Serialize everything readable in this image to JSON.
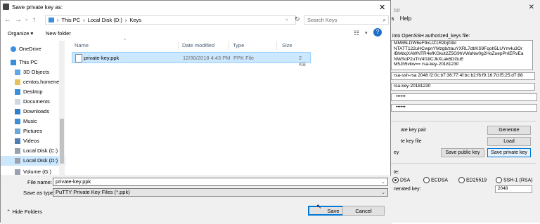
{
  "background_window": {
    "title_fragment": "tor",
    "menu": [
      "ns",
      "Help"
    ],
    "pubkey_label": "into OpenSSH authorized_keys file:",
    "pubkey_lines": [
      "MM85LDW6eF9xLtZ1R2bj03kl",
      "NTATT122uHCwpnYMzgb/zauYXRL7dt/KS9Fqoh5LUYm4u3Or",
      "IBMdqXAWNTR4efKGkut2Z5G9hVWaNw0g2HoZuepPnIERvEa",
      "NWSoP2uTn/4f1ltCJkXLak6DGuE",
      "M5Jh5vkw== rsa-key-20181230"
    ],
    "fingerprint": "rsa-ssh-rsa 2048 f2:0c:b7:36:77:4f:bc:b2:f6:f9:16:7d:f5:25:d7:88",
    "comment": "rsa-key-20181230",
    "passphrase": "••••••",
    "confirm": "••••••",
    "gen_label": "ate key pair",
    "load_label": "te key file",
    "save_label": "ey",
    "generate_btn": "Generate",
    "load_btn": "Load",
    "save_public_btn": "Save public key",
    "save_private_btn": "Save private key",
    "type_label": "te:",
    "radio_rsa": "DSA",
    "radio_ecdsa": "ECDSA",
    "radio_ed25519": "ED25519",
    "radio_ssh1": "SSH-1 (RSA)",
    "bits_label": "nerated key:",
    "bits_value": "2048"
  },
  "dialog": {
    "title": "Save private key as:",
    "close": "✕",
    "breadcrumb": [
      "This PC",
      "Local Disk (D:)",
      "Keys"
    ],
    "search_placeholder": "Search Keys",
    "organize": "Organize ▾",
    "new_folder": "New folder",
    "columns": {
      "name": "Name",
      "date": "Date modified",
      "type": "Type",
      "size": "Size"
    },
    "nav": [
      {
        "label": "OneDrive",
        "icon": "cloud-icon"
      },
      {
        "label": "This PC",
        "icon": "computer-icon"
      },
      {
        "label": "3D Objects",
        "icon": "folder-3d-icon"
      },
      {
        "label": "centos.homenet",
        "icon": "folder-icon"
      },
      {
        "label": "Desktop",
        "icon": "folder-icon"
      },
      {
        "label": "Documents",
        "icon": "documents-icon"
      },
      {
        "label": "Downloads",
        "icon": "downloads-icon"
      },
      {
        "label": "Music",
        "icon": "music-icon"
      },
      {
        "label": "Pictures",
        "icon": "pictures-icon"
      },
      {
        "label": "Videos",
        "icon": "videos-icon"
      },
      {
        "label": "Local Disk (C:)",
        "icon": "drive-icon"
      },
      {
        "label": "Local Disk (D:)",
        "icon": "drive-icon"
      },
      {
        "label": "Volume (G:)",
        "icon": "drive-icon"
      }
    ],
    "file": {
      "name": "private-key.ppk",
      "date": "12/30/2018 4:43 PM",
      "type": "PPK File",
      "size": "2 KB"
    },
    "filename_label": "File name:",
    "filename_value": "private-key.ppk",
    "savetype_label": "Save as type:",
    "savetype_value": "PuTTY Private Key Files (*.ppk)",
    "hide_folders": "Hide Folders",
    "save_btn": "Save",
    "cancel_btn": "Cancel"
  },
  "colors": {
    "selection": "#cce8ff",
    "accent": "#0078d7"
  }
}
